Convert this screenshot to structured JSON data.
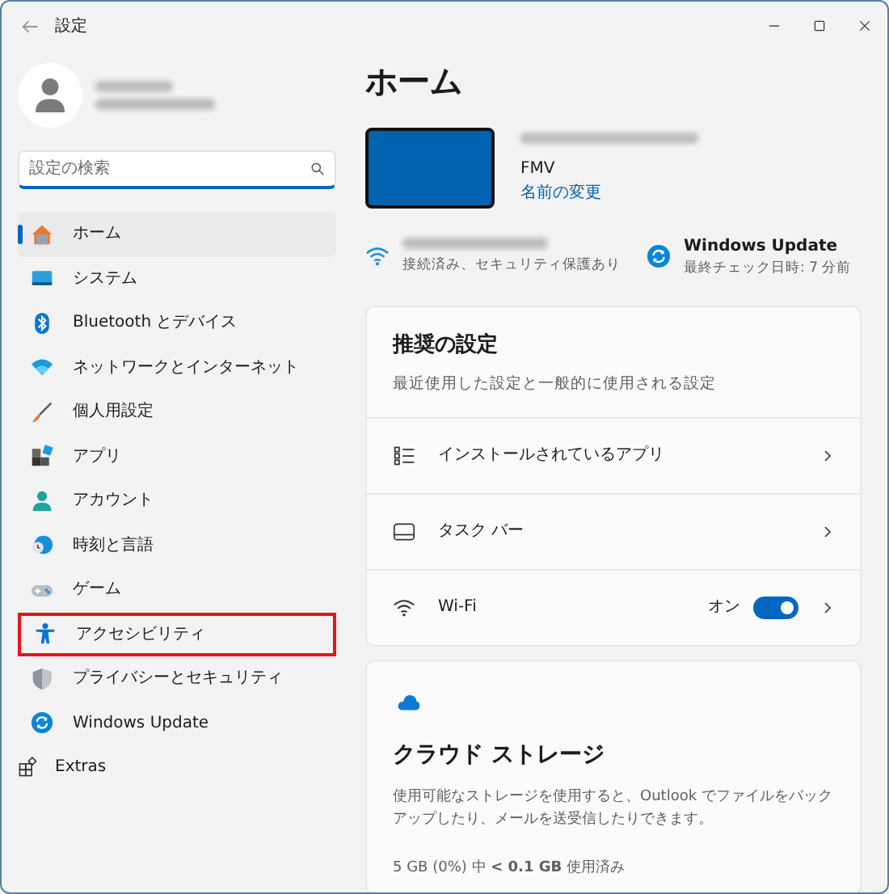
{
  "window": {
    "title": "設定"
  },
  "sidebar": {
    "search": {
      "placeholder": "設定の検索"
    },
    "items": [
      {
        "kind": "home",
        "label": "ホーム",
        "selected": true,
        "highlighted": false
      },
      {
        "kind": "system",
        "label": "システム",
        "selected": false,
        "highlighted": false
      },
      {
        "kind": "bluetooth",
        "label": "Bluetooth とデバイス",
        "selected": false,
        "highlighted": false
      },
      {
        "kind": "network",
        "label": "ネットワークとインターネット",
        "selected": false,
        "highlighted": false
      },
      {
        "kind": "personal",
        "label": "個人用設定",
        "selected": false,
        "highlighted": false
      },
      {
        "kind": "apps",
        "label": "アプリ",
        "selected": false,
        "highlighted": false
      },
      {
        "kind": "account",
        "label": "アカウント",
        "selected": false,
        "highlighted": false
      },
      {
        "kind": "time",
        "label": "時刻と言語",
        "selected": false,
        "highlighted": false
      },
      {
        "kind": "game",
        "label": "ゲーム",
        "selected": false,
        "highlighted": false
      },
      {
        "kind": "accessibility",
        "label": "アクセシビリティ",
        "selected": false,
        "highlighted": true
      },
      {
        "kind": "privacy",
        "label": "プライバシーとセキュリティ",
        "selected": false,
        "highlighted": false
      },
      {
        "kind": "update",
        "label": "Windows Update",
        "selected": false,
        "highlighted": false
      }
    ],
    "extras": {
      "label": "Extras"
    }
  },
  "main": {
    "title": "ホーム",
    "device": {
      "model": "FMV",
      "rename_link": "名前の変更"
    },
    "status": [
      {
        "kind": "wifi",
        "detail": "接続済み、セキュリティ保護あり"
      },
      {
        "kind": "update",
        "title": "Windows Update",
        "detail": "最終チェック日時: 7 分前"
      }
    ],
    "recommended": {
      "title": "推奨の設定",
      "subtitle": "最近使用した設定と一般的に使用される設定",
      "rows": [
        {
          "kind": "apps",
          "label": "インストールされているアプリ"
        },
        {
          "kind": "taskbar",
          "label": "タスク バー"
        },
        {
          "kind": "wifi",
          "label": "Wi-Fi",
          "toggle_label": "オン",
          "on": true
        }
      ]
    },
    "cloud": {
      "title": "クラウド ストレージ",
      "description": "使用可能なストレージを使用すると、Outlook でファイルをバックアップしたり、メールを送受信したりできます。",
      "usage": "5 GB (0%) 中 **< 0.1 GB** 使用済み"
    }
  }
}
